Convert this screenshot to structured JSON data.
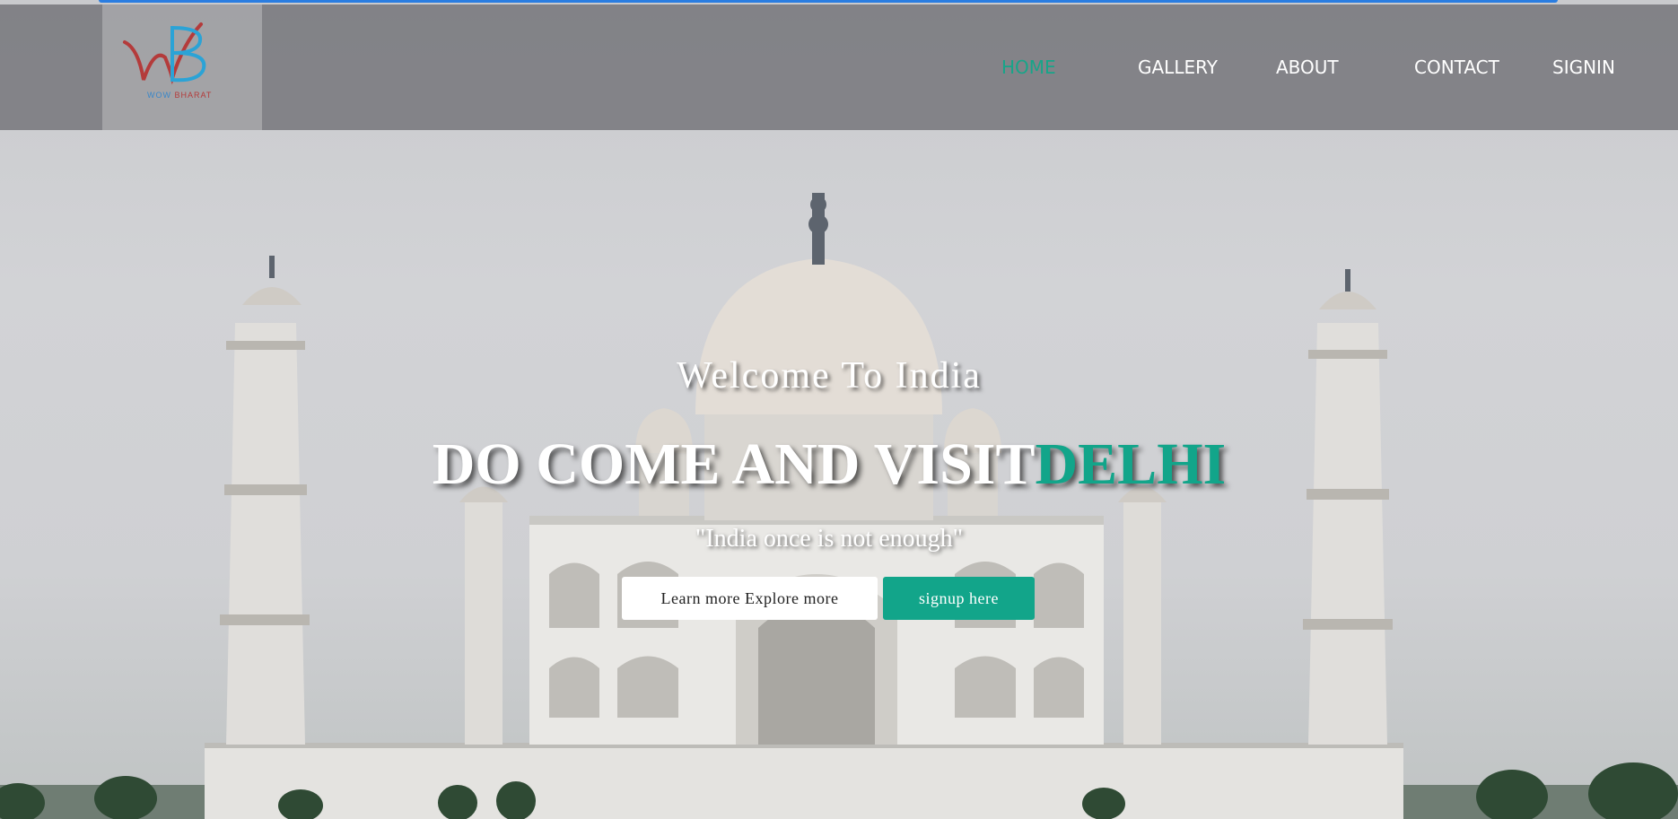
{
  "header": {
    "logo": {
      "name": "wow-bharat-logo",
      "caption_part1": "WOW",
      "caption_part2": "BHARAT"
    },
    "nav": [
      {
        "label": "HOME",
        "active": true
      },
      {
        "label": "GALLERY",
        "active": false
      },
      {
        "label": "ABOUT",
        "active": false
      },
      {
        "label": "CONTACT",
        "active": false
      },
      {
        "label": "SIGNIN",
        "active": false
      }
    ]
  },
  "hero": {
    "welcome": "Welcome To India",
    "headline_main": "DO COME AND VISIT",
    "headline_accent": "DELHI",
    "tagline": "\"India once is not enough\"",
    "buttons": {
      "learn_more": "Learn more Explore more",
      "signup": "signup here"
    }
  },
  "colors": {
    "accent": "#12a58a",
    "nav_active": "#17a589",
    "navbar_bg": "#6e6e73",
    "focus_bar": "#2a7de1"
  }
}
